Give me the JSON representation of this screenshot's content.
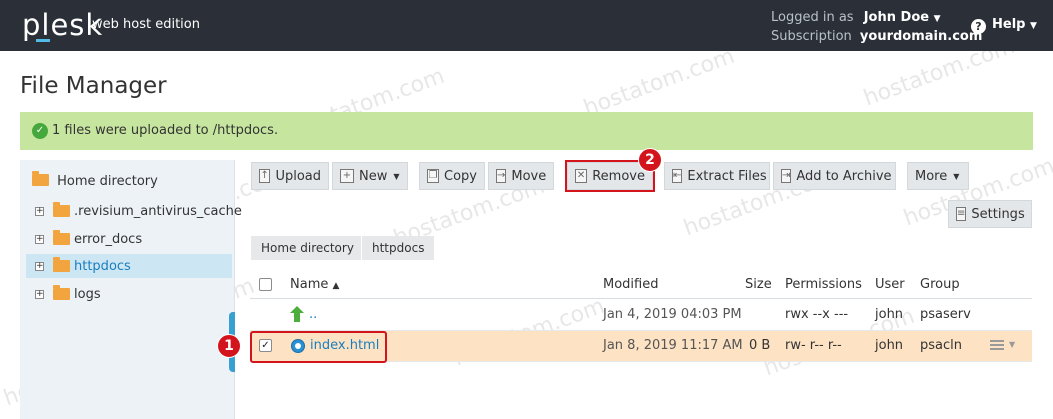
{
  "header": {
    "logo": "plesk",
    "edition": "web host edition",
    "logged_in_label": "Logged in as",
    "user_name": "John Doe",
    "subscription_label": "Subscription",
    "subscription_value": "yourdomain.com",
    "help_label": "Help",
    "help_icon": "question-circle-icon",
    "bg_color": "#2b3038"
  },
  "page": {
    "title": "File Manager"
  },
  "message": {
    "text": "1 files were uploaded to /httpdocs.",
    "icon": "check-circle-icon",
    "bg_color": "#c6e6a0"
  },
  "sidebar": {
    "root": "Home directory",
    "items": [
      {
        "label": ".revisium_antivirus_cache",
        "selected": false
      },
      {
        "label": "error_docs",
        "selected": false
      },
      {
        "label": "httpdocs",
        "selected": true
      },
      {
        "label": "logs",
        "selected": false
      }
    ]
  },
  "toolbar": {
    "upload": "Upload",
    "new": "New",
    "copy": "Copy",
    "move": "Move",
    "remove": "Remove",
    "extract": "Extract Files",
    "archive": "Add to Archive",
    "more": "More",
    "settings": "Settings"
  },
  "breadcrumb": [
    "Home directory",
    "httpdocs"
  ],
  "table": {
    "headers": {
      "name": "Name",
      "modified": "Modified",
      "size": "Size",
      "permissions": "Permissions",
      "user": "User",
      "group": "Group"
    },
    "sort_indicator": "▲",
    "rows": [
      {
        "name": "..",
        "modified": "Jan 4, 2019 04:03 PM",
        "size": "",
        "permissions": "rwx --x ---",
        "user": "john",
        "group": "psaserv",
        "checked": false
      },
      {
        "name": "index.html",
        "modified": "Jan 8, 2019 11:17 AM",
        "size": "0 B",
        "permissions": "rw- r-- r--",
        "user": "john",
        "group": "psacln",
        "checked": true
      }
    ]
  },
  "annotations": {
    "step1": "1",
    "step2": "2",
    "color": "#d3141d"
  },
  "watermark": "hostatom.com"
}
